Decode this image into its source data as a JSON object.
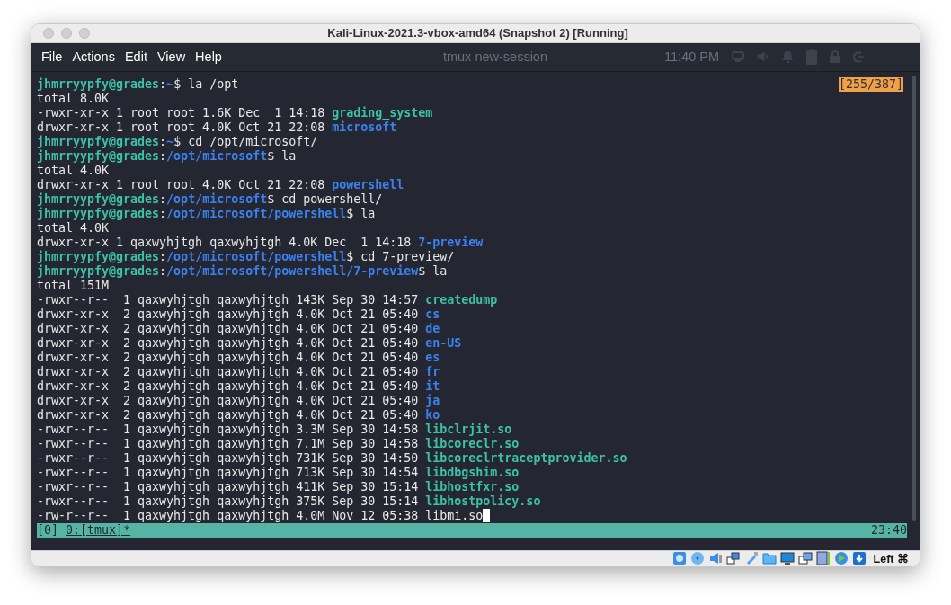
{
  "window": {
    "title": "Kali-Linux-2021.3-vbox-amd64 (Snapshot 2) [Running]"
  },
  "menu": [
    "File",
    "Actions",
    "Edit",
    "View",
    "Help"
  ],
  "desktop_panel": {
    "task": "tmux new-session",
    "clock": "11:40 PM"
  },
  "scroll_position": "[255/387]",
  "lines": [
    {
      "kind": "prompt",
      "user": "jhmrryypfy@grades",
      "separator": ":",
      "path": "~",
      "symbol": "$",
      "command": " la /opt"
    },
    {
      "kind": "text",
      "text": "total 8.0K"
    },
    {
      "kind": "entry",
      "info": "-rwxr-xr-x 1 root root 1.6K Dec  1 14:18 ",
      "name": "grading_system",
      "color": "#3cc2a8",
      "bold": true
    },
    {
      "kind": "entry",
      "info": "drwxr-xr-x 1 root root 4.0K Oct 21 22:08 ",
      "name": "microsoft",
      "color": "#3b82f0",
      "bold": true
    },
    {
      "kind": "prompt",
      "user": "jhmrryypfy@grades",
      "separator": ":",
      "path": "~",
      "symbol": "$",
      "command": " cd /opt/microsoft/"
    },
    {
      "kind": "prompt",
      "user": "jhmrryypfy@grades",
      "separator": ":",
      "path": "/opt/microsoft",
      "symbol": "$",
      "command": " la"
    },
    {
      "kind": "text",
      "text": "total 4.0K"
    },
    {
      "kind": "entry",
      "info": "drwxr-xr-x 1 root root 4.0K Oct 21 22:08 ",
      "name": "powershell",
      "color": "#3b82f0",
      "bold": true
    },
    {
      "kind": "prompt",
      "user": "jhmrryypfy@grades",
      "separator": ":",
      "path": "/opt/microsoft",
      "symbol": "$",
      "command": " cd powershell/"
    },
    {
      "kind": "prompt",
      "user": "jhmrryypfy@grades",
      "separator": ":",
      "path": "/opt/microsoft/powershell",
      "symbol": "$",
      "command": " la"
    },
    {
      "kind": "text",
      "text": "total 4.0K"
    },
    {
      "kind": "entry",
      "info": "drwxr-xr-x 1 qaxwyhjtgh qaxwyhjtgh 4.0K Dec  1 14:18 ",
      "name": "7-preview",
      "color": "#3b82f0",
      "bold": true
    },
    {
      "kind": "prompt",
      "user": "jhmrryypfy@grades",
      "separator": ":",
      "path": "/opt/microsoft/powershell",
      "symbol": "$",
      "command": " cd 7-preview/"
    },
    {
      "kind": "prompt",
      "user": "jhmrryypfy@grades",
      "separator": ":",
      "path": "/opt/microsoft/powershell/7-preview",
      "symbol": "$",
      "command": " la"
    },
    {
      "kind": "text",
      "text": "total 151M"
    },
    {
      "kind": "entry",
      "info": "-rwxr--r--  1 qaxwyhjtgh qaxwyhjtgh 143K Sep 30 14:57 ",
      "name": "createdump",
      "color": "#3cc2a8",
      "bold": true
    },
    {
      "kind": "entry",
      "info": "drwxr-xr-x  2 qaxwyhjtgh qaxwyhjtgh 4.0K Oct 21 05:40 ",
      "name": "cs",
      "color": "#3b82f0",
      "bold": true
    },
    {
      "kind": "entry",
      "info": "drwxr-xr-x  2 qaxwyhjtgh qaxwyhjtgh 4.0K Oct 21 05:40 ",
      "name": "de",
      "color": "#3b82f0",
      "bold": true
    },
    {
      "kind": "entry",
      "info": "drwxr-xr-x  2 qaxwyhjtgh qaxwyhjtgh 4.0K Oct 21 05:40 ",
      "name": "en-US",
      "color": "#3b82f0",
      "bold": true
    },
    {
      "kind": "entry",
      "info": "drwxr-xr-x  2 qaxwyhjtgh qaxwyhjtgh 4.0K Oct 21 05:40 ",
      "name": "es",
      "color": "#3b82f0",
      "bold": true
    },
    {
      "kind": "entry",
      "info": "drwxr-xr-x  2 qaxwyhjtgh qaxwyhjtgh 4.0K Oct 21 05:40 ",
      "name": "fr",
      "color": "#3b82f0",
      "bold": true
    },
    {
      "kind": "entry",
      "info": "drwxr-xr-x  2 qaxwyhjtgh qaxwyhjtgh 4.0K Oct 21 05:40 ",
      "name": "it",
      "color": "#3b82f0",
      "bold": true
    },
    {
      "kind": "entry",
      "info": "drwxr-xr-x  2 qaxwyhjtgh qaxwyhjtgh 4.0K Oct 21 05:40 ",
      "name": "ja",
      "color": "#3b82f0",
      "bold": true
    },
    {
      "kind": "entry",
      "info": "drwxr-xr-x  2 qaxwyhjtgh qaxwyhjtgh 4.0K Oct 21 05:40 ",
      "name": "ko",
      "color": "#3b82f0",
      "bold": true
    },
    {
      "kind": "entry",
      "info": "-rwxr--r--  1 qaxwyhjtgh qaxwyhjtgh 3.3M Sep 30 14:58 ",
      "name": "libclrjit.so",
      "color": "#3cc2a8",
      "bold": true
    },
    {
      "kind": "entry",
      "info": "-rwxr--r--  1 qaxwyhjtgh qaxwyhjtgh 7.1M Sep 30 14:58 ",
      "name": "libcoreclr.so",
      "color": "#3cc2a8",
      "bold": true
    },
    {
      "kind": "entry",
      "info": "-rwxr--r--  1 qaxwyhjtgh qaxwyhjtgh 731K Sep 30 14:50 ",
      "name": "libcoreclrtraceptprovider.so",
      "color": "#3cc2a8",
      "bold": true
    },
    {
      "kind": "entry",
      "info": "-rwxr--r--  1 qaxwyhjtgh qaxwyhjtgh 713K Sep 30 14:54 ",
      "name": "libdbgshim.so",
      "color": "#3cc2a8",
      "bold": true
    },
    {
      "kind": "entry",
      "info": "-rwxr--r--  1 qaxwyhjtgh qaxwyhjtgh 411K Sep 30 15:14 ",
      "name": "libhostfxr.so",
      "color": "#3cc2a8",
      "bold": true
    },
    {
      "kind": "entry",
      "info": "-rwxr--r--  1 qaxwyhjtgh qaxwyhjtgh 375K Sep 30 15:14 ",
      "name": "libhostpolicy.so",
      "color": "#3cc2a8",
      "bold": true
    },
    {
      "kind": "entry",
      "info": "-rw-r--r--  1 qaxwyhjtgh qaxwyhjtgh 4.0M Nov 12 05:38 ",
      "name": "libmi.so",
      "color": "#e8e8e8",
      "bold": false,
      "cursor": true
    }
  ],
  "tmux_status": {
    "session": "[0]",
    "window": "0:[tmux]*",
    "time": "23:40"
  },
  "host_key": "Left ⌘"
}
